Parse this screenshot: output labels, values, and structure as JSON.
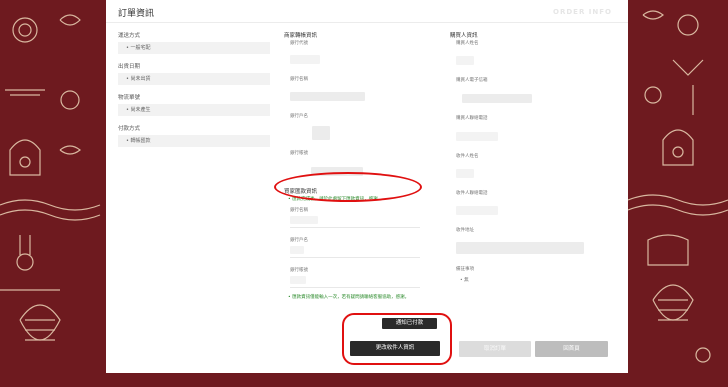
{
  "header": {
    "title": "訂單資訊",
    "watermark": "ORDER INFO"
  },
  "left": {
    "groups": [
      {
        "label": "運送方式",
        "value": "一般宅配"
      },
      {
        "label": "出貨日期",
        "value": "尚未出貨"
      },
      {
        "label": "物流單號",
        "value": "尚未產生"
      },
      {
        "label": "付款方式",
        "value": "轉帳匯款"
      }
    ]
  },
  "merchant": {
    "title": "商家轉帳資訊",
    "fields": [
      "銀行代號",
      "銀行名稱",
      "銀行戶名",
      "銀行帳號"
    ]
  },
  "buyer_bank": {
    "title": "買家匯款資訊",
    "hint": "匯款完成後，請於此處留下匯款資訊，感謝。",
    "fields": [
      "銀行名稱",
      "銀行戶名",
      "銀行帳號"
    ],
    "note": "匯款資訊僅能輸入一次，若有疑問請聯絡客服協助，感謝。"
  },
  "buyer": {
    "title": "購買人資訊",
    "fields": [
      "購買人姓名",
      "購買人電子信箱",
      "購買人聯絡電話",
      "收件人姓名",
      "收件人聯絡電話",
      "收件地址"
    ],
    "remarks_label": "備註事項",
    "remarks_value": "無"
  },
  "actions": {
    "notify_paid": "通知已付款",
    "change_recipient": "更改收件人資訊",
    "cancel_order": "取消訂單",
    "home": "回首頁"
  },
  "colors": {
    "frame": "#6e1a1f",
    "highlight": "#e01010",
    "hint": "#2a8a2a"
  }
}
